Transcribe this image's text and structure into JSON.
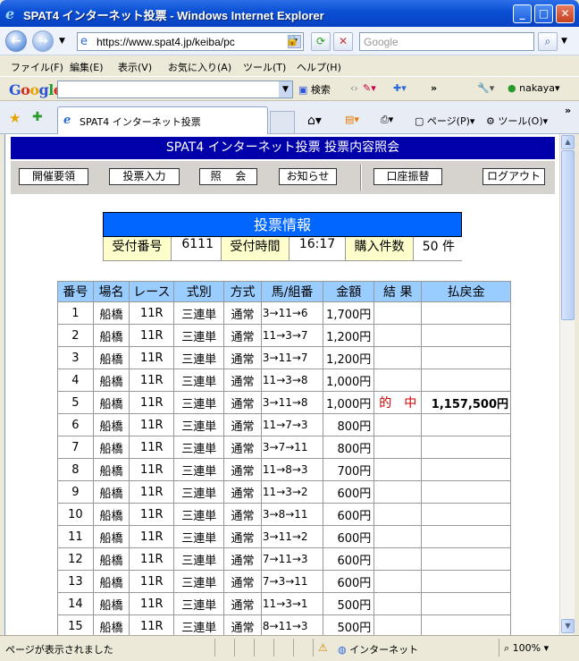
{
  "window": {
    "title": "SPAT4 インターネット投票 - Windows Internet Explorer",
    "min": "_",
    "max": "□",
    "close": "✕"
  },
  "nav": {
    "url": "https://www.spat4.jp/keiba/pc",
    "search_placeholder": "Google"
  },
  "menu": [
    "ファイル(F)",
    "編集(E)",
    "表示(V)",
    "お気に入り(A)",
    "ツール(T)",
    "ヘルプ(H)"
  ],
  "google_toolbar": {
    "logo": "Google",
    "search_label": "検索",
    "user": "nakaya"
  },
  "tabs": {
    "active_label": "SPAT4 インターネット投票",
    "page_menu": "ページ(P)",
    "tools_menu": "ツール(O)"
  },
  "page": {
    "header": "SPAT4 インターネット投票 投票内容照会",
    "nav_buttons": [
      "開催要領",
      "投票入力",
      "照　 会",
      "お知らせ",
      "口座振替",
      "ログアウト"
    ],
    "info": {
      "title": "投票情報",
      "receipt_label": "受付番号",
      "receipt_value": "6111",
      "time_label": "受付時間",
      "time_value": "16:17",
      "count_label": "購入件数",
      "count_value": "50 件"
    },
    "table": {
      "headers": [
        "番号",
        "場名",
        "レース",
        "式別",
        "方式",
        "馬/組番",
        "金額",
        "結 果",
        "払戻金"
      ],
      "rows": [
        [
          "1",
          "船橋",
          "11R",
          "三連単",
          "通常",
          "3→11→6",
          "1,700円",
          "",
          ""
        ],
        [
          "2",
          "船橋",
          "11R",
          "三連単",
          "通常",
          "11→3→7",
          "1,200円",
          "",
          ""
        ],
        [
          "3",
          "船橋",
          "11R",
          "三連単",
          "通常",
          "3→11→7",
          "1,200円",
          "",
          ""
        ],
        [
          "4",
          "船橋",
          "11R",
          "三連単",
          "通常",
          "11→3→8",
          "1,000円",
          "",
          ""
        ],
        [
          "5",
          "船橋",
          "11R",
          "三連単",
          "通常",
          "3→11→8",
          "1,000円",
          "的　中",
          "1,157,500円"
        ],
        [
          "6",
          "船橋",
          "11R",
          "三連単",
          "通常",
          "11→7→3",
          "800円",
          "",
          ""
        ],
        [
          "7",
          "船橋",
          "11R",
          "三連単",
          "通常",
          "3→7→11",
          "800円",
          "",
          ""
        ],
        [
          "8",
          "船橋",
          "11R",
          "三連単",
          "通常",
          "11→8→3",
          "700円",
          "",
          ""
        ],
        [
          "9",
          "船橋",
          "11R",
          "三連単",
          "通常",
          "11→3→2",
          "600円",
          "",
          ""
        ],
        [
          "10",
          "船橋",
          "11R",
          "三連単",
          "通常",
          "3→8→11",
          "600円",
          "",
          ""
        ],
        [
          "11",
          "船橋",
          "11R",
          "三連単",
          "通常",
          "3→11→2",
          "600円",
          "",
          ""
        ],
        [
          "12",
          "船橋",
          "11R",
          "三連単",
          "通常",
          "7→11→3",
          "600円",
          "",
          ""
        ],
        [
          "13",
          "船橋",
          "11R",
          "三連単",
          "通常",
          "7→3→11",
          "600円",
          "",
          ""
        ],
        [
          "14",
          "船橋",
          "11R",
          "三連単",
          "通常",
          "11→3→1",
          "500円",
          "",
          ""
        ],
        [
          "15",
          "船橋",
          "11R",
          "三連単",
          "通常",
          "8→11→3",
          "500円",
          "",
          ""
        ]
      ]
    }
  },
  "status": {
    "text": "ページが表示されました",
    "zone": "インターネット",
    "zoom": "100%"
  },
  "colors": {
    "header_bg": "#0000aa",
    "info_title_bg": "#0066ff",
    "table_header_bg": "#99ccff",
    "hit_text": "#cc0000"
  }
}
